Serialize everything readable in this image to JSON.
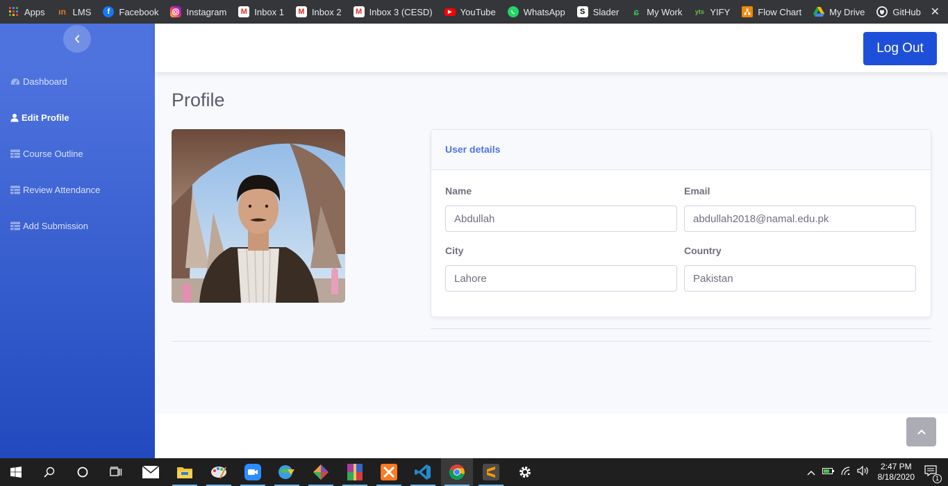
{
  "bookmarks": [
    {
      "label": "Apps",
      "icon": "apps-grid-icon",
      "color": "#4285f4"
    },
    {
      "label": "LMS",
      "icon": "lms-icon",
      "color": "#e87722"
    },
    {
      "label": "Facebook",
      "icon": "facebook-icon",
      "color": "#1877f2"
    },
    {
      "label": "Instagram",
      "icon": "instagram-icon",
      "color": "#d6249f"
    },
    {
      "label": "Inbox 1",
      "icon": "gmail-icon",
      "color": "#d93025"
    },
    {
      "label": "Inbox 2",
      "icon": "gmail-icon",
      "color": "#d93025"
    },
    {
      "label": "Inbox 3 (CESD)",
      "icon": "gmail-icon",
      "color": "#d93025"
    },
    {
      "label": "YouTube",
      "icon": "youtube-icon",
      "color": "#ff0000"
    },
    {
      "label": "WhatsApp",
      "icon": "whatsapp-icon",
      "color": "#25d366"
    },
    {
      "label": "Slader",
      "icon": "slader-icon",
      "color": "#000000"
    },
    {
      "label": "My Work",
      "icon": "mywork-icon",
      "color": "#3cba54"
    },
    {
      "label": "YIFY",
      "icon": "yify-icon",
      "color": "#6ac045"
    },
    {
      "label": "Flow Chart",
      "icon": "flowchart-icon",
      "color": "#f08705"
    },
    {
      "label": "My Drive",
      "icon": "google-drive-icon",
      "color": "#1fa463"
    },
    {
      "label": "GitHub",
      "icon": "github-icon",
      "color": "#ffffff"
    }
  ],
  "sidebar": {
    "items": [
      {
        "label": "Dashboard",
        "icon": "tachometer-icon",
        "active": false
      },
      {
        "label": "Edit Profile",
        "icon": "user-icon",
        "active": true
      },
      {
        "label": "Course Outline",
        "icon": "table-icon",
        "active": false
      },
      {
        "label": "Review Attendance",
        "icon": "table-icon",
        "active": false
      },
      {
        "label": "Add Submission",
        "icon": "table-icon",
        "active": false
      }
    ]
  },
  "topbar": {
    "logout_label": "Log Out"
  },
  "page": {
    "title": "Profile"
  },
  "user_details": {
    "header": "User details",
    "name_label": "Name",
    "name_value": "Abdullah",
    "email_label": "Email",
    "email_value": "abdullah2018@namal.edu.pk",
    "city_label": "City",
    "city_value": "Lahore",
    "country_label": "Country",
    "country_value": "Pakistan"
  },
  "taskbar": {
    "time": "2:47 PM",
    "date": "8/18/2020",
    "notification_count": "1"
  },
  "colors": {
    "sidebar_top": "#4e73df",
    "sidebar_bottom": "#224abe",
    "primary_button": "#1e4fd8",
    "card_title": "#4e73df"
  }
}
